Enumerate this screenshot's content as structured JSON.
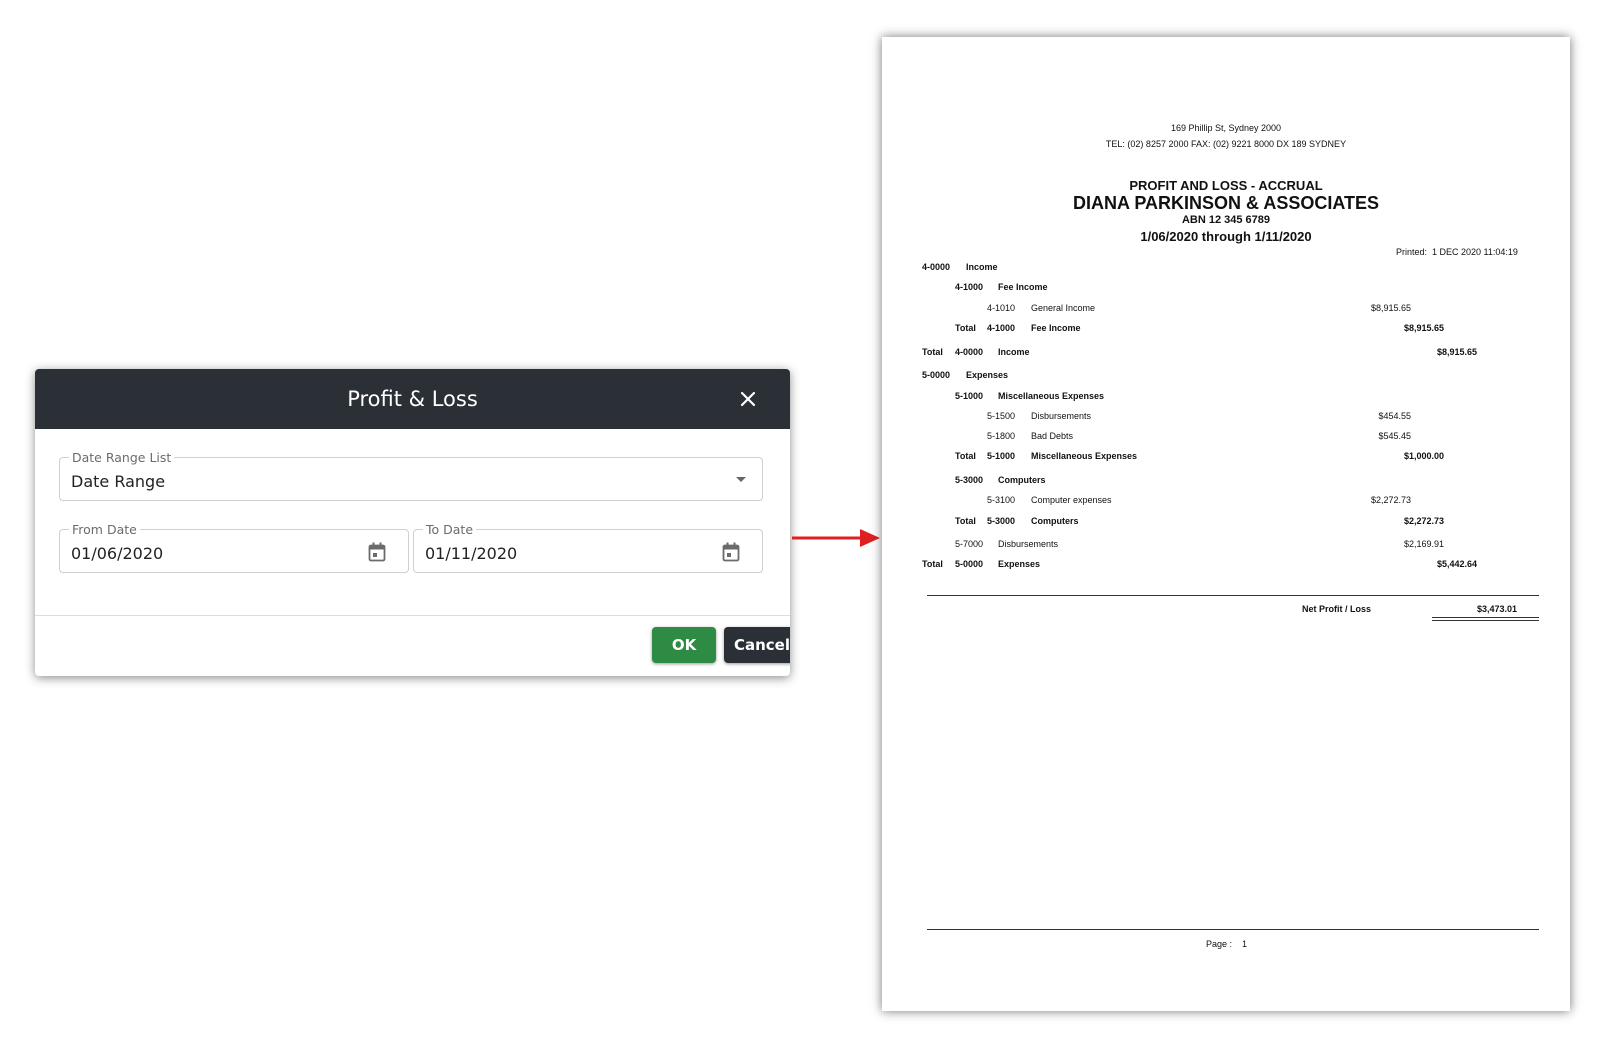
{
  "dialog": {
    "title": "Profit & Loss",
    "date_range_list": {
      "label": "Date Range List",
      "value": "Date Range"
    },
    "from_date": {
      "label": "From Date",
      "value": "01/06/2020"
    },
    "to_date": {
      "label": "To Date",
      "value": "01/11/2020"
    },
    "ok_label": "OK",
    "cancel_label": "Cancel",
    "colors": {
      "header": "#2b2f36",
      "ok": "#2e8b44",
      "cancel": "#2b2f36"
    }
  },
  "arrow": {
    "color": "#e02020",
    "icon": "arrow-right-icon"
  },
  "report": {
    "address": "169 Phillip St, Sydney 2000",
    "contact": "TEL: (02) 8257 2000 FAX: (02) 9221 8000 DX 189 SYDNEY",
    "report_title": "PROFIT AND LOSS - ACCRUAL",
    "company": "DIANA PARKINSON & ASSOCIATES",
    "abn": "ABN 12 345 6789",
    "period": "1/06/2020 through  1/11/2020",
    "printed_label": "Printed:",
    "printed_value": "1 DEC 2020   11:04:19",
    "rows": [
      {
        "total": "",
        "code": "4-0000",
        "name": "Income",
        "amount": ""
      },
      {
        "total": "",
        "code": "4-1000",
        "name": "Fee Income",
        "amount": ""
      },
      {
        "total": "",
        "code": "4-1010",
        "name": "General Income",
        "amount": "$8,915.65"
      },
      {
        "total": "Total",
        "code": "4-1000",
        "name": "Fee Income",
        "amount": "$8,915.65"
      },
      {
        "total": "Total",
        "code": "4-0000",
        "name": "Income",
        "amount": "$8,915.65"
      },
      {
        "total": "",
        "code": "5-0000",
        "name": "Expenses",
        "amount": ""
      },
      {
        "total": "",
        "code": "5-1000",
        "name": "Miscellaneous Expenses",
        "amount": ""
      },
      {
        "total": "",
        "code": "5-1500",
        "name": "Disbursements",
        "amount": "$454.55"
      },
      {
        "total": "",
        "code": "5-1800",
        "name": "Bad Debts",
        "amount": "$545.45"
      },
      {
        "total": "Total",
        "code": "5-1000",
        "name": "Miscellaneous Expenses",
        "amount": "$1,000.00"
      },
      {
        "total": "",
        "code": "5-3000",
        "name": "Computers",
        "amount": ""
      },
      {
        "total": "",
        "code": "5-3100",
        "name": "Computer expenses",
        "amount": "$2,272.73"
      },
      {
        "total": "Total",
        "code": "5-3000",
        "name": "Computers",
        "amount": "$2,272.73"
      },
      {
        "total": "",
        "code": "5-7000",
        "name": "Disbursements",
        "amount": "$2,169.91"
      },
      {
        "total": "Total",
        "code": "5-0000",
        "name": "Expenses",
        "amount": "$5,442.64"
      }
    ],
    "net_label": "Net Profit / Loss",
    "net_value": "$3,473.01",
    "page_label": "Page :",
    "page_number": "1"
  }
}
